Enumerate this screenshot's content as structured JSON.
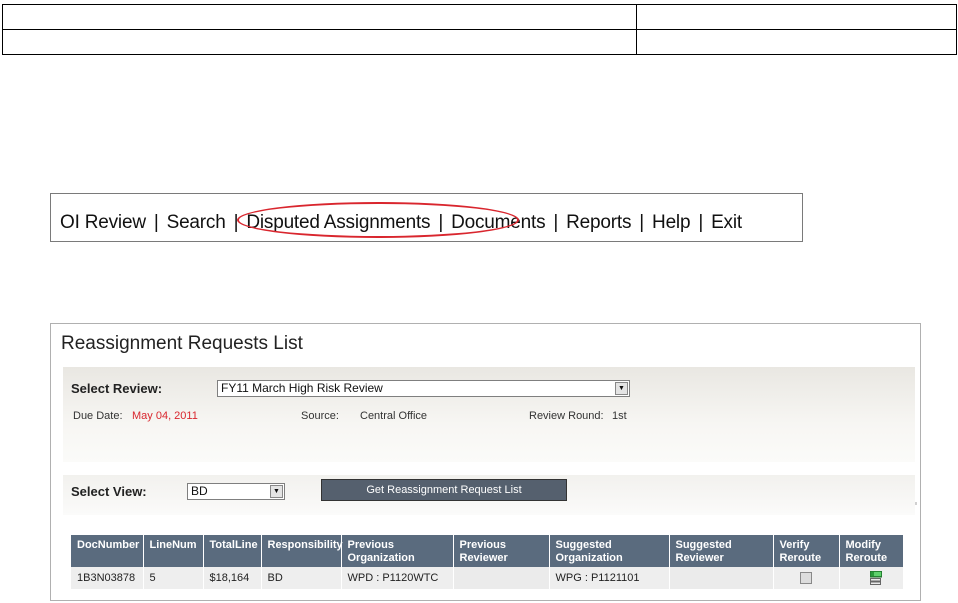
{
  "nav": {
    "items": [
      "OI Review",
      "Search",
      "Disputed Assignments",
      "Documents",
      "Reports",
      "Help",
      "Exit"
    ],
    "separator": "|",
    "highlighted": "Disputed Assignments",
    "highlight_color": "#d9262e"
  },
  "panel": {
    "title": "Reassignment Requests List",
    "select_review_label": "Select Review:",
    "select_review_value": "FY11 March High Risk Review",
    "due_date_label": "Due Date:",
    "due_date_value": "May 04, 2011",
    "source_label": "Source:",
    "source_value": "Central Office",
    "review_round_label": "Review Round:",
    "review_round_value": "1st",
    "select_view_label": "Select View:",
    "select_view_value": "BD",
    "get_button_label": "Get Reassignment Request List"
  },
  "table": {
    "headers": [
      "DocNumber",
      "LineNum",
      "TotalLine",
      "Responsibility",
      "Previous Organization",
      "Previous Reviewer",
      "Suggested Organization",
      "Suggested Reviewer",
      "Verify Reroute",
      "Modify Reroute"
    ],
    "rows": [
      {
        "DocNumber": "1B3N03878",
        "LineNum": "5",
        "TotalLine": "$18,164",
        "Responsibility": "BD",
        "PreviousOrganization": "WPD : P1120WTC",
        "PreviousReviewer": "",
        "SuggestedOrganization": "WPG : P1121101",
        "SuggestedReviewer": ""
      }
    ]
  },
  "colors": {
    "header_bg": "#5a6b7e",
    "due_date": "#d9262e",
    "button_bg": "#55606e"
  }
}
